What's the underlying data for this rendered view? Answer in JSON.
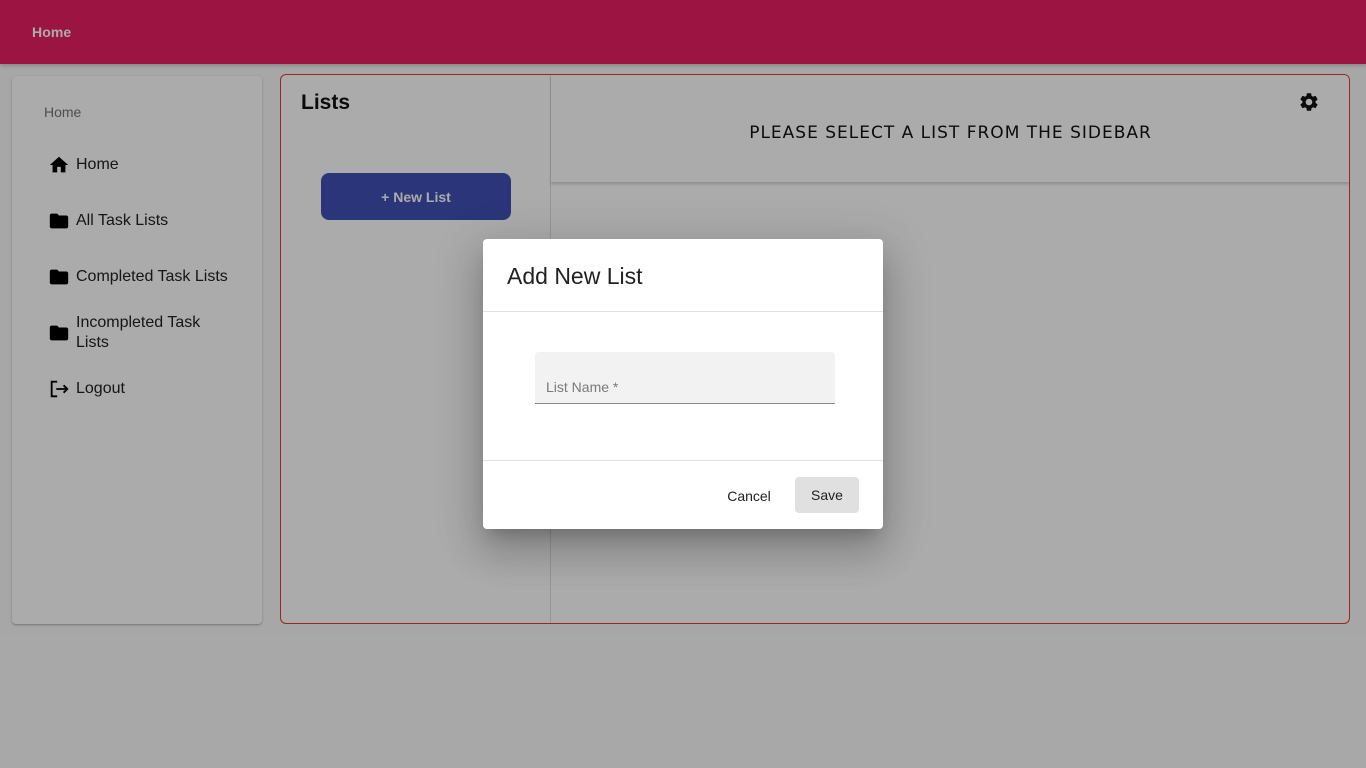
{
  "topbar": {
    "brand": "Home"
  },
  "sidebar": {
    "subheader": "Home",
    "items": [
      {
        "label": "Home",
        "icon": "home-icon"
      },
      {
        "label": "All Task Lists",
        "icon": "folder-icon"
      },
      {
        "label": "Completed Task Lists",
        "icon": "folder-icon"
      },
      {
        "label": "Incompleted Task Lists",
        "icon": "folder-icon"
      },
      {
        "label": "Logout",
        "icon": "logout-icon"
      }
    ]
  },
  "lists": {
    "title": "Lists",
    "new_list_label": "+ New List"
  },
  "content": {
    "message": "PLEASE SELECT A LIST FROM THE SIDEBAR",
    "settings_icon": "gear-icon"
  },
  "dialog": {
    "title": "Add New List",
    "field_placeholder": "List Name *",
    "field_value": "",
    "cancel_label": "Cancel",
    "save_label": "Save"
  },
  "colors": {
    "topbar": "#e91e63",
    "primary_button": "#3f51b5",
    "main_border": "#e53935"
  }
}
